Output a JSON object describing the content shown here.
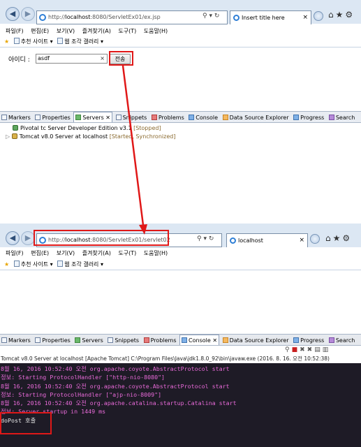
{
  "browser1": {
    "url_prefix": "http://",
    "url_host": "localhost",
    "url_rest": ":8080/ServletEx01/ex.jsp",
    "tab_title": "Insert title here",
    "menu": [
      "파일(F)",
      "편집(E)",
      "보기(V)",
      "즐겨찾기(A)",
      "도구(T)",
      "도움말(H)"
    ],
    "fav_items": [
      "추천 사이트 ▾",
      "웹 조각 갤러리 ▾"
    ],
    "form": {
      "label": "아이디 :",
      "value": "asdf",
      "clear": "×",
      "submit": "전송"
    }
  },
  "views1": {
    "tabs": [
      "Markers",
      "Properties",
      "Servers",
      "Snippets",
      "Problems",
      "Console",
      "Data Source Explorer",
      "Progress",
      "Search"
    ],
    "servers": [
      {
        "name": "Pivotal tc Server Developer Edition v3.1",
        "status": "[Stopped]"
      },
      {
        "name": "Tomcat v8.0 Server at localhost",
        "status": "[Started, Synchronized]"
      }
    ]
  },
  "browser2": {
    "url_prefix": "http://",
    "url_host": "localhost",
    "url_rest": ":8080/ServletEx01/servlet02",
    "tab_title": "localhost",
    "menu": [
      "파일(F)",
      "편집(E)",
      "보기(V)",
      "즐겨찾기(A)",
      "도구(T)",
      "도움말(H)"
    ],
    "fav_items": [
      "추천 사이트 ▾",
      "웹 조각 갤러리 ▾"
    ]
  },
  "views2": {
    "tabs": [
      "Markers",
      "Properties",
      "Servers",
      "Snippets",
      "Problems",
      "Console",
      "Data Source Explorer",
      "Progress",
      "Search"
    ],
    "console_desc": "Tomcat v8.0 Server at localhost [Apache Tomcat] C:\\Program Files\\Java\\jdk1.8.0_92\\bin\\javaw.exe (2016. 8. 16. 오전 10:52:38)",
    "lines": [
      "8월 16, 2016 10:52:40 오전 org.apache.coyote.AbstractProtocol start",
      "정보: Starting ProtocolHandler [\"http-nio-8080\"]",
      "8월 16, 2016 10:52:40 오전 org.apache.coyote.AbstractProtocol start",
      "정보: Starting ProtocolHandler [\"ajp-nio-8009\"]",
      "8월 16, 2016 10:52:40 오전 org.apache.catalina.startup.Catalina start",
      "정보: Server startup in 1449 ms",
      "doPost 호출"
    ]
  },
  "colors": {
    "annotation": "#e01818",
    "console_bg": "#1e1b26",
    "stderr": "#e86ad8",
    "stdout": "#e8e8e8"
  }
}
